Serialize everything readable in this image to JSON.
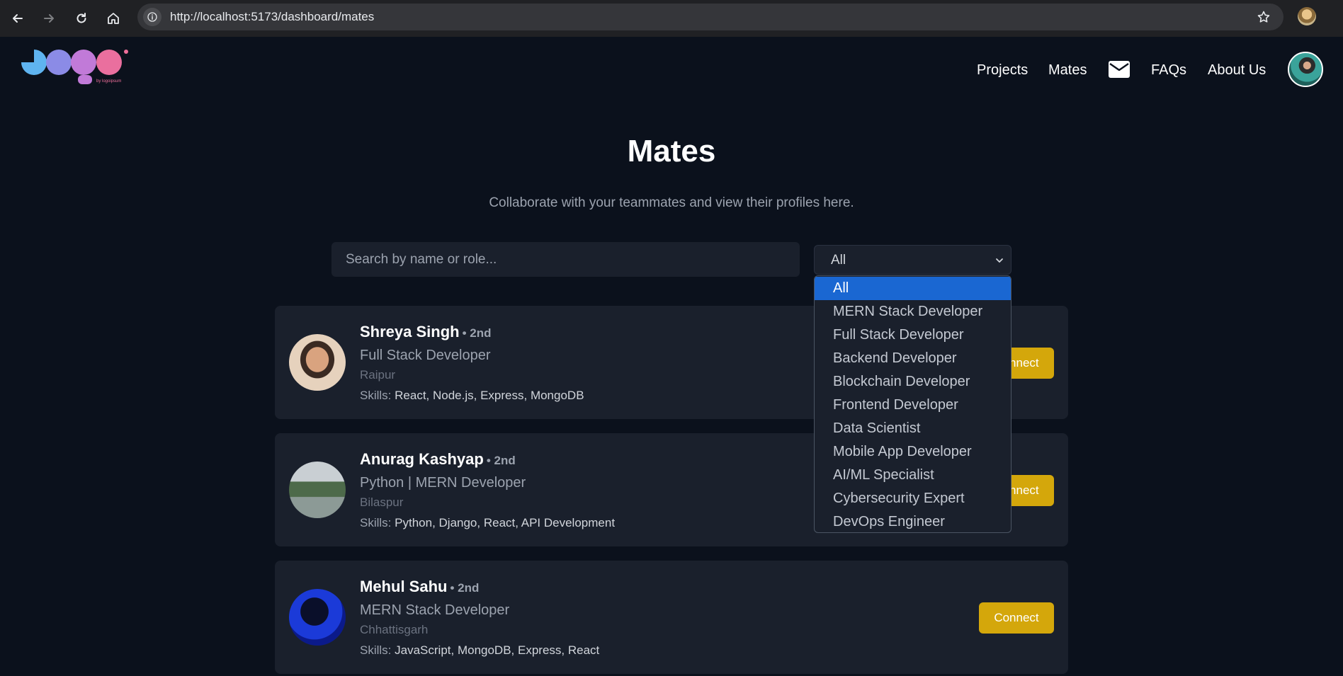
{
  "browser": {
    "url": "http://localhost:5173/dashboard/mates"
  },
  "header": {
    "logo_text": "Logo",
    "logo_tagline": "by logoipsum",
    "nav": {
      "projects": "Projects",
      "mates": "Mates",
      "faqs": "FAQs",
      "about": "About Us"
    }
  },
  "main": {
    "title": "Mates",
    "subtitle": "Collaborate with your teammates and view their profiles here.",
    "search_placeholder": "Search by name or role...",
    "filter": {
      "selected": "All",
      "options": [
        "All",
        "MERN Stack Developer",
        "Full Stack Developer",
        "Backend Developer",
        "Blockchain Developer",
        "Frontend Developer",
        "Data Scientist",
        "Mobile App Developer",
        "AI/ML Specialist",
        "Cybersecurity Expert",
        "DevOps Engineer"
      ]
    },
    "skills_label": "Skills:",
    "connect_label": "Connect",
    "mates": [
      {
        "name": "Shreya Singh",
        "degree": "• 2nd",
        "role": "Full Stack Developer",
        "location": "Raipur",
        "skills": "React, Node.js, Express, MongoDB"
      },
      {
        "name": "Anurag Kashyap",
        "degree": "• 2nd",
        "role": "Python | MERN Developer",
        "location": "Bilaspur",
        "skills": "Python, Django, React, API Development"
      },
      {
        "name": "Mehul Sahu",
        "degree": "• 2nd",
        "role": "MERN Stack Developer",
        "location": "Chhattisgarh",
        "skills": "JavaScript, MongoDB, Express, React"
      }
    ]
  },
  "colors": {
    "background": "#0b111c",
    "card": "#1a202c",
    "accent": "#d4a70b",
    "selected_option": "#1a67d2"
  }
}
